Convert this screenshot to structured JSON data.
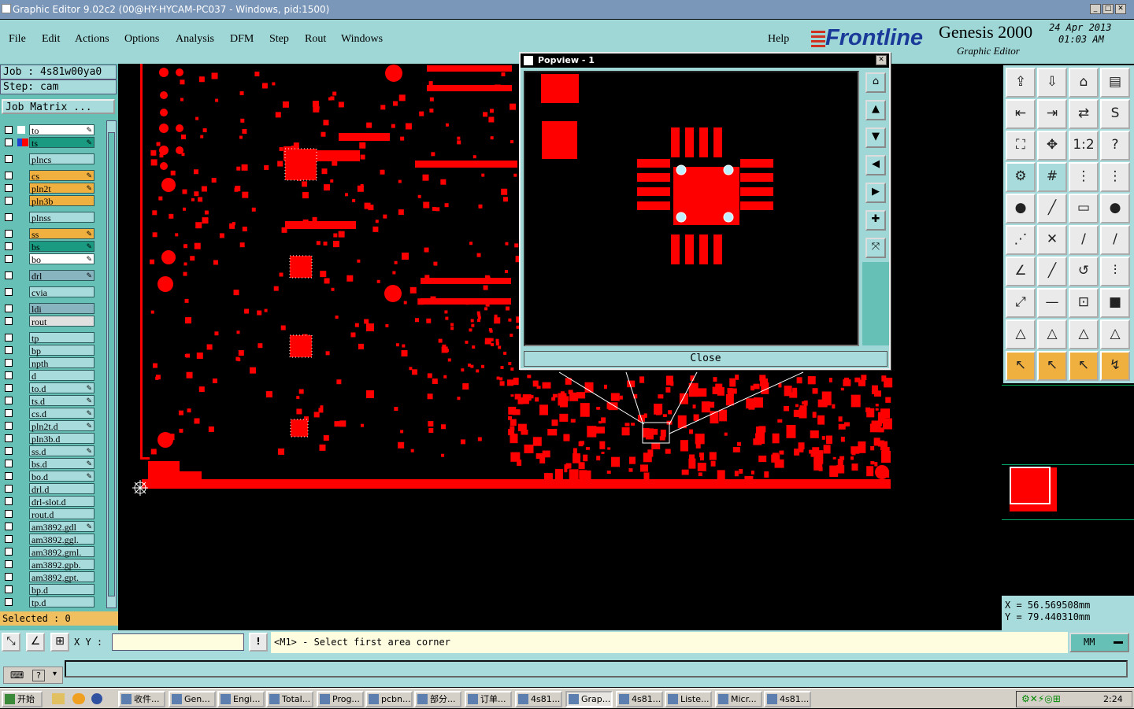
{
  "window": {
    "title": "Graphic Editor 9.02c2 (00@HY-HYCAM-PC037 - Windows, pid:1500)"
  },
  "menu": [
    "File",
    "Edit",
    "Actions",
    "Options",
    "Analysis",
    "DFM",
    "Step",
    "Rout",
    "Windows"
  ],
  "help_label": "Help",
  "brand": {
    "logo": "Frontline",
    "product": "Genesis 2000",
    "subtitle": "Graphic Editor",
    "date": "24 Apr 2013",
    "time": "01:03 AM"
  },
  "job": {
    "job_label": "Job : 4s81w00ya0",
    "step_label": "Step: cam",
    "matrix_button": "Job Matrix ..."
  },
  "layers": [
    {
      "name": "to",
      "color": "#ffffff",
      "mark": "#ffffff",
      "editable": true
    },
    {
      "name": "ts",
      "color": "#1a9a80",
      "mark": "#ff0000",
      "editable": true
    },
    {
      "name": "plncs",
      "color": "#a8dcdc",
      "mark": "",
      "editable": false
    },
    {
      "name": "cs",
      "color": "#f0b040",
      "mark": "",
      "editable": true
    },
    {
      "name": "pln2t",
      "color": "#f0b040",
      "mark": "",
      "editable": true
    },
    {
      "name": "pln3b",
      "color": "#f0b040",
      "mark": "",
      "editable": false
    },
    {
      "name": "plnss",
      "color": "#a8dcdc",
      "mark": "",
      "editable": false
    },
    {
      "name": "ss",
      "color": "#f0b040",
      "mark": "",
      "editable": true
    },
    {
      "name": "bs",
      "color": "#1a9a80",
      "mark": "",
      "editable": true
    },
    {
      "name": "bo",
      "color": "#ffffff",
      "mark": "",
      "editable": true
    },
    {
      "name": "drl",
      "color": "#88b4c0",
      "mark": "",
      "editable": true
    },
    {
      "name": "cvia",
      "color": "#a8dcdc",
      "mark": "",
      "editable": false
    },
    {
      "name": "ldi",
      "color": "#88b4c0",
      "mark": "",
      "editable": false
    },
    {
      "name": "rout",
      "color": "#e0e0e0",
      "mark": "",
      "editable": false
    },
    {
      "name": "tp",
      "color": "#a8dcdc",
      "mark": "",
      "editable": false
    },
    {
      "name": "bp",
      "color": "#a8dcdc",
      "mark": "",
      "editable": false
    },
    {
      "name": "npth",
      "color": "#a8dcdc",
      "mark": "",
      "editable": false
    },
    {
      "name": "d",
      "color": "#a8dcdc",
      "mark": "",
      "editable": false
    },
    {
      "name": "to.d",
      "color": "#a8dcdc",
      "mark": "",
      "editable": true
    },
    {
      "name": "ts.d",
      "color": "#a8dcdc",
      "mark": "",
      "editable": true
    },
    {
      "name": "cs.d",
      "color": "#a8dcdc",
      "mark": "",
      "editable": true
    },
    {
      "name": "pln2t.d",
      "color": "#a8dcdc",
      "mark": "",
      "editable": true
    },
    {
      "name": "pln3b.d",
      "color": "#a8dcdc",
      "mark": "",
      "editable": false
    },
    {
      "name": "ss.d",
      "color": "#a8dcdc",
      "mark": "",
      "editable": true
    },
    {
      "name": "bs.d",
      "color": "#a8dcdc",
      "mark": "",
      "editable": true
    },
    {
      "name": "bo.d",
      "color": "#a8dcdc",
      "mark": "",
      "editable": true
    },
    {
      "name": "drl.d",
      "color": "#a8dcdc",
      "mark": "",
      "editable": false
    },
    {
      "name": "drl-slot.d",
      "color": "#a8dcdc",
      "mark": "",
      "editable": false
    },
    {
      "name": "rout.d",
      "color": "#a8dcdc",
      "mark": "",
      "editable": false
    },
    {
      "name": "am3892.gdl",
      "color": "#a8dcdc",
      "mark": "",
      "editable": true
    },
    {
      "name": "am3892.ggl.",
      "color": "#a8dcdc",
      "mark": "",
      "editable": false
    },
    {
      "name": "am3892.gml.",
      "color": "#a8dcdc",
      "mark": "",
      "editable": false
    },
    {
      "name": "am3892.gpb.",
      "color": "#a8dcdc",
      "mark": "",
      "editable": false
    },
    {
      "name": "am3892.gpt.",
      "color": "#a8dcdc",
      "mark": "",
      "editable": false
    },
    {
      "name": "bp.d",
      "color": "#a8dcdc",
      "mark": "",
      "editable": false
    },
    {
      "name": "tp.d",
      "color": "#a8dcdc",
      "mark": "",
      "editable": false
    }
  ],
  "selected_label": "Selected : 0",
  "popview": {
    "title": "Popview - 1",
    "close_label": "Close"
  },
  "coords": {
    "x": "X  =  56.569508mm",
    "y": "Y  =  79.440310mm"
  },
  "status": {
    "xy_label": "X Y :",
    "message": "<M1> - Select first area corner",
    "units": "MM"
  },
  "taskbar": {
    "start": "开始",
    "clock": "2:24",
    "items": [
      "收件...",
      "Gen...",
      "Engi...",
      "Total...",
      "Prog...",
      "pcbn...",
      "部分...",
      "订单...",
      "4s81...",
      "Grap...",
      "4s81...",
      "Liste...",
      "Micr...",
      "4s81..."
    ]
  }
}
